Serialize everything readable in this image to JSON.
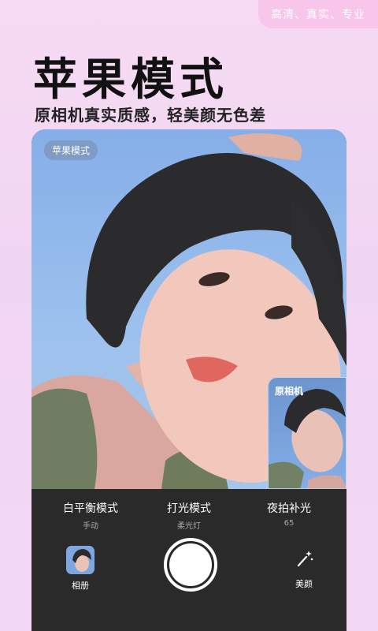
{
  "tagline": "高清、真实、专业",
  "hero": {
    "title": "苹果模式",
    "subtitle": "原相机真实质感，轻美颜无色差"
  },
  "preview": {
    "mode_badge": "苹果模式",
    "original_label": "原相机"
  },
  "options": [
    {
      "label": "白平衡模式",
      "value": "手动"
    },
    {
      "label": "打光模式",
      "value": "柔光灯"
    },
    {
      "label": "夜拍补光",
      "value": "65"
    }
  ],
  "bottom_bar": {
    "album_label": "相册",
    "beauty_label": "美颜"
  },
  "colors": {
    "background": "#f3d8f6",
    "panel": "#2a2a2a",
    "accent_pill": "#f7c6ea"
  }
}
